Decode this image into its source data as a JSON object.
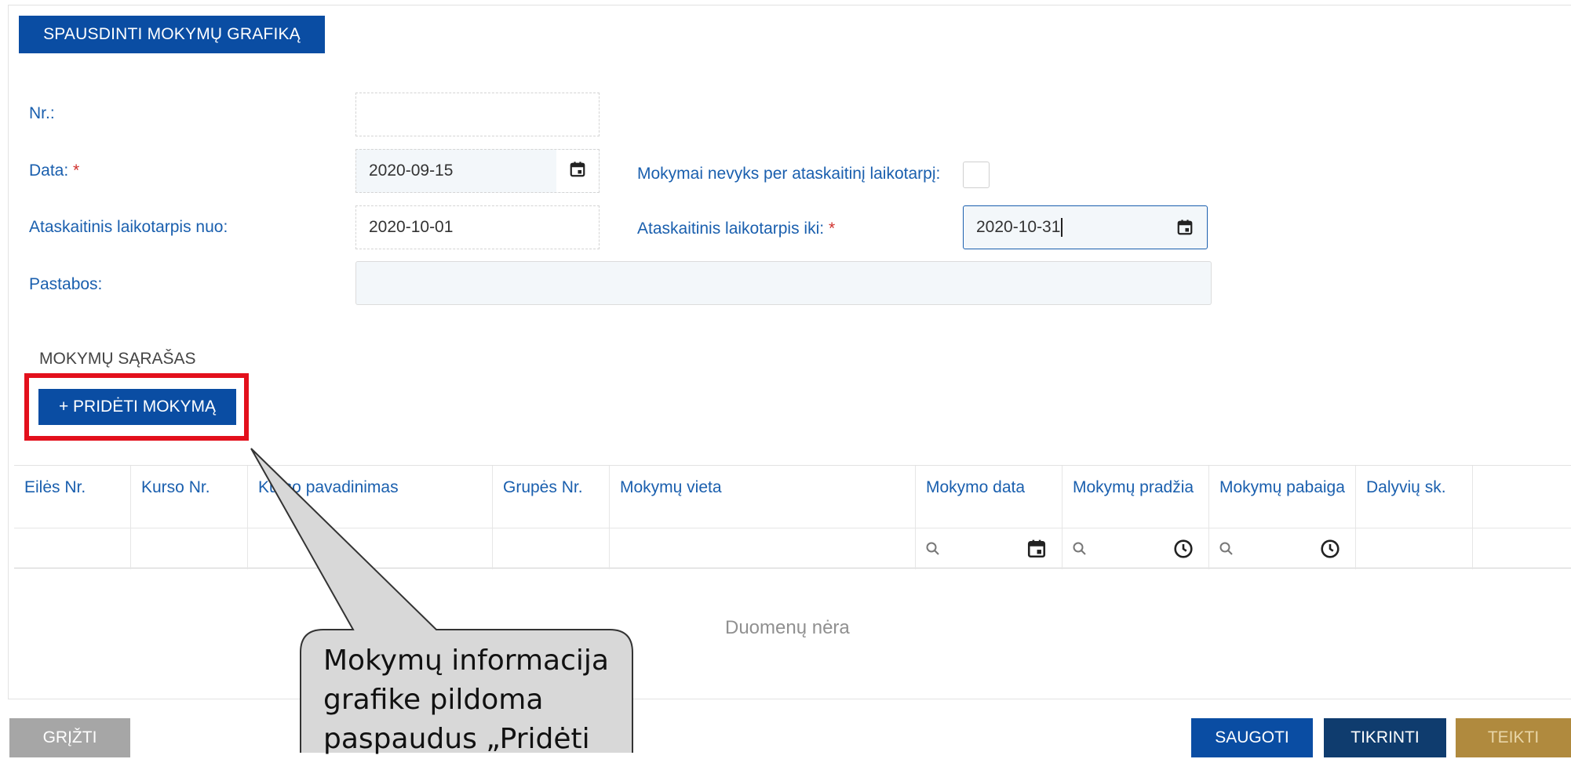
{
  "toolbar": {
    "print_label": "SPAUSDINTI MOKYMŲ GRAFIKĄ"
  },
  "form": {
    "nr_label": "Nr.:",
    "nr_value": "",
    "date_label": "Data:",
    "required_mark": "*",
    "date_value": "2020-09-15",
    "no_training_label": "Mokymai nevyks per ataskaitinį laikotarpį:",
    "period_from_label": "Ataskaitinis laikotarpis nuo:",
    "period_from_value": "2020-10-01",
    "period_to_label": "Ataskaitinis laikotarpis iki:",
    "period_to_value": "2020-10-31",
    "notes_label": "Pastabos:",
    "notes_value": ""
  },
  "list": {
    "title": "MOKYMŲ SĄRAŠAS",
    "add_label": "+ PRIDĖTI MOKYMĄ",
    "columns": [
      "Eilės Nr.",
      "Kurso Nr.",
      "Kurso pavadinimas",
      "Grupės Nr.",
      "Mokymų vieta",
      "Mokymo data",
      "Mokymų pradžia",
      "Mokymų pabaiga",
      "Dalyvių sk."
    ],
    "empty_text": "Duomenų nėra"
  },
  "actions": {
    "back_label": "GRĮŽTI",
    "save_label": "SAUGOTI",
    "check_label": "TIKRINTI",
    "submit_label": "TEIKTI"
  },
  "callout": {
    "text": "Mokymų informacija grafike pildoma paspaudus „Pridėti"
  },
  "colors": {
    "primary": "#0a4da3",
    "label": "#1a5fae",
    "required": "#d0312d",
    "highlight": "#e3101c",
    "back": "#a6a6a6",
    "check": "#0f3c6e",
    "submit": "#b08a3e"
  }
}
